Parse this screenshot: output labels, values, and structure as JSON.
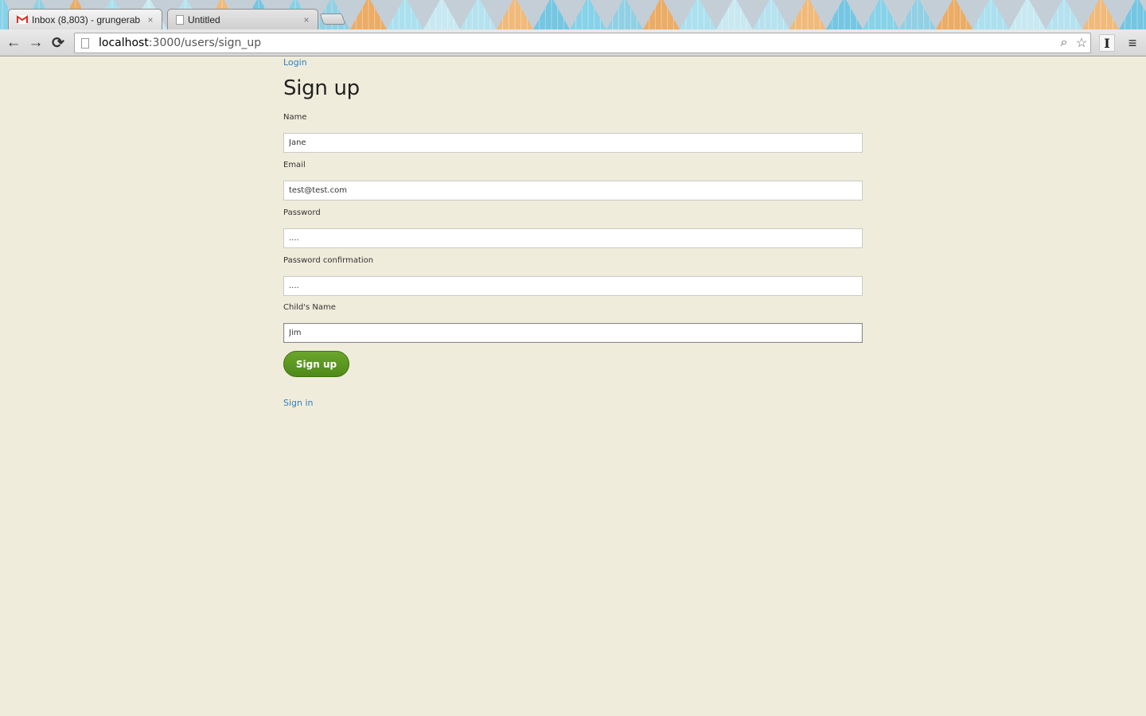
{
  "browser": {
    "tabs": [
      {
        "title": "Inbox (8,803) - grungerab",
        "close": "×",
        "icon": "gmail-icon"
      },
      {
        "title": "Untitled",
        "close": "×",
        "icon": "page-icon"
      }
    ],
    "address_bar": {
      "host": "localhost",
      "rest": ":3000/users/sign_up"
    },
    "buttons": {
      "back": "←",
      "forward": "→",
      "reload": "⟳",
      "search": "⌕",
      "bookmark": "☆",
      "extension": "I",
      "menu": "≡"
    }
  },
  "page": {
    "login_link": "Login",
    "title": "Sign up",
    "fields": [
      {
        "label": "Name",
        "value": "Jane",
        "type": "text"
      },
      {
        "label": "Email",
        "value": "test@test.com",
        "type": "email"
      },
      {
        "label": "Password",
        "value": "....",
        "type": "password"
      },
      {
        "label": "Password confirmation",
        "value": "....",
        "type": "password"
      },
      {
        "label": "Child's Name",
        "value": "Jim",
        "type": "text"
      }
    ],
    "submit_label": "Sign up",
    "signin_link": "Sign in"
  },
  "colors": {
    "background": "#f0ecdb",
    "link": "#2e7fbf",
    "button": "#5a9622"
  }
}
